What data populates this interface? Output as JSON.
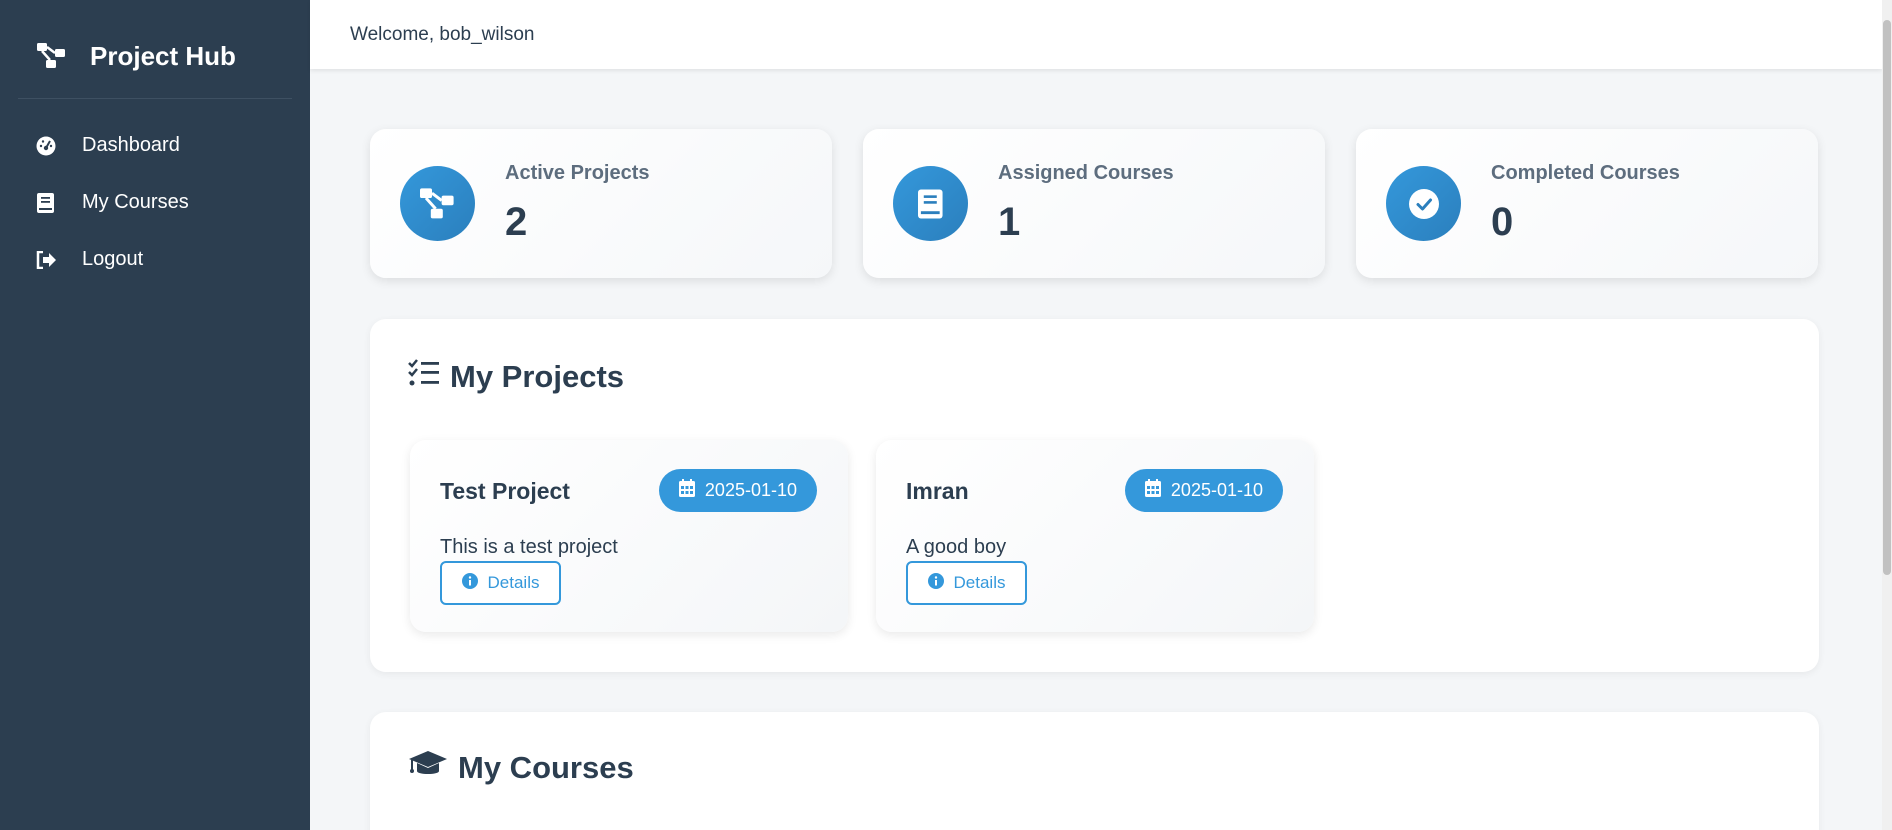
{
  "sidebar": {
    "brand": {
      "icon": "project-diagram-icon",
      "title": "Project Hub"
    },
    "items": [
      {
        "icon": "tachometer-icon",
        "label": "Dashboard"
      },
      {
        "icon": "book-icon",
        "label": "My Courses"
      },
      {
        "icon": "sign-out-icon",
        "label": "Logout"
      }
    ]
  },
  "header": {
    "welcome": "Welcome, bob_wilson"
  },
  "stats": [
    {
      "icon": "project-diagram-icon",
      "label": "Active Projects",
      "value": "2"
    },
    {
      "icon": "book-icon",
      "label": "Assigned Courses",
      "value": "1"
    },
    {
      "icon": "check-circle-icon",
      "label": "Completed Courses",
      "value": "0"
    }
  ],
  "projects_section": {
    "icon": "tasks-icon",
    "title": "My Projects",
    "projects": [
      {
        "name": "Test Project",
        "date": "2025-01-10",
        "description": "This is a test project",
        "details_label": "Details"
      },
      {
        "name": "Imran",
        "date": "2025-01-10",
        "description": "A good boy",
        "details_label": "Details"
      }
    ]
  },
  "courses_section": {
    "icon": "graduation-cap-icon",
    "title": "My Courses"
  },
  "colors": {
    "sidebar": "#2c3e50",
    "accent": "#3498db",
    "background": "#f4f6f8"
  }
}
